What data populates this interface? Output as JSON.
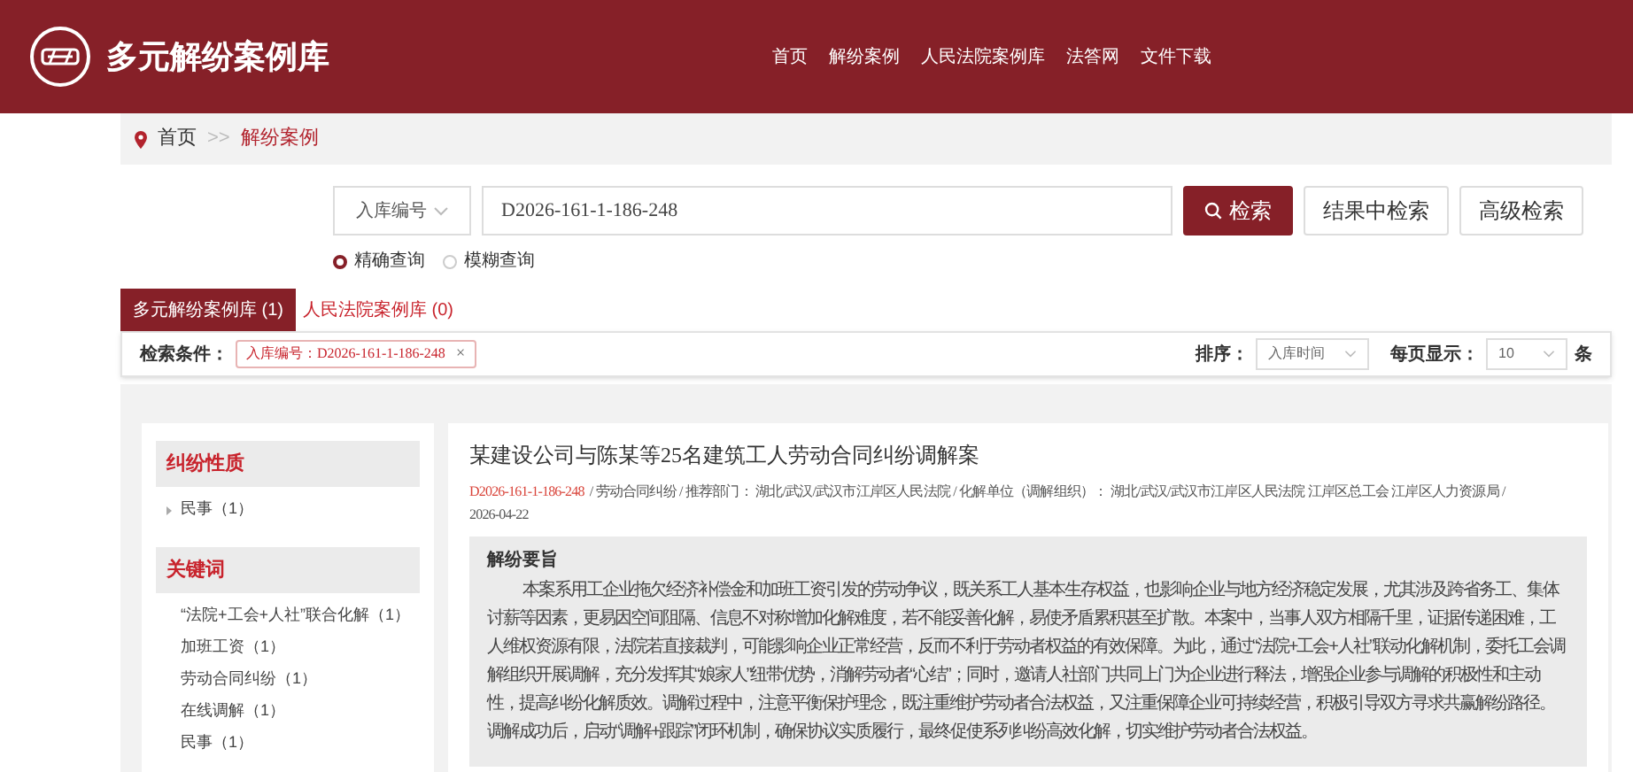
{
  "header": {
    "site_title": "多元解纷案例库",
    "nav": [
      {
        "label": "首页"
      },
      {
        "label": "解纷案例"
      },
      {
        "label": "人民法院案例库"
      },
      {
        "label": "法答网"
      },
      {
        "label": "文件下载"
      }
    ]
  },
  "breadcrumb": [
    {
      "label": "首页",
      "kind": "link",
      "current": false
    },
    {
      "label": ">>",
      "kind": "separator"
    },
    {
      "label": "解纷案例",
      "kind": "link",
      "current": true
    }
  ],
  "search": {
    "field": "入库编号",
    "value": "D2026-161-1-186-248",
    "buttons": [
      {
        "label": "检索",
        "kind": "primary"
      },
      {
        "label": "结果中检索",
        "kind": "secondary"
      },
      {
        "label": "高级检索",
        "kind": "secondary"
      }
    ],
    "modes": [
      {
        "label": "精确查询",
        "selected": true
      },
      {
        "label": "模糊查询",
        "selected": false
      }
    ]
  },
  "tabs": [
    {
      "label": "多元解纷案例库 (1)",
      "selected": true
    },
    {
      "label": "人民法院案例库 (0)",
      "selected": false
    }
  ],
  "filters": {
    "label": "检索条件：",
    "tags": [
      {
        "label": "入库编号：D2026-161-1-186-248",
        "close": "×"
      }
    ],
    "sort_label": "排序：",
    "sort_value": "入库时间",
    "page_size_label": "每页显示：",
    "page_size": "10",
    "page_size_unit": "条"
  },
  "sidebar": [
    {
      "title": "纠纷性质",
      "items": [
        {
          "label": "民事（1）",
          "kind": "bullet"
        }
      ]
    },
    {
      "title": "关键词",
      "items": [
        {
          "label": "“法院+工会+人社”联合化解（1）",
          "kind": "plain"
        },
        {
          "label": "加班工资（1）",
          "kind": "plain"
        },
        {
          "label": "劳动合同纠纷（1）",
          "kind": "plain"
        },
        {
          "label": "在线调解（1）",
          "kind": "plain"
        },
        {
          "label": "民事（1）",
          "kind": "plain"
        }
      ]
    }
  ],
  "result": {
    "title": "某建设公司与陈某等25名建筑工人劳动合同纠纷调解案",
    "case_no": "D2026-161-1-186-248",
    "details": "/ 劳动合同纠纷 / 推荐部门： 湖北/武汉/武汉市江岸区人民法院 / 化解单位（调解组织）： 湖北/武汉/武汉市江岸区人民法院 江岸区总工会 江岸区人力资源局 /",
    "date": "2026-04-22",
    "summary_heading": "解纷要旨",
    "summary": "本案系用工企业拖欠经济补偿金和加班工资引发的劳动争议，既关系工人基本生存权益，也影响企业与地方经济稳定发展，尤其涉及跨省务工、集体讨薪等因素，更易因空间阻隔、信息不对称增加化解难度，若不能妥善化解，易使矛盾累积甚至扩散。本案中，当事人双方相隔千里，证据传递困难，工人维权资源有限，法院若直接裁判，可能影响企业正常经营，反而不利于劳动者权益的有效保障。为此，通过“法院+工会+人社”联动化解机制，委托工会调解组织开展调解，充分发挥其“娘家人”纽带优势，消解劳动者“心结”；同时，邀请人社部门共同上门为企业进行释法，增强企业参与调解的积极性和主动性，提高纠纷化解质效。调解过程中，注意平衡保护理念，既注重维护劳动者合法权益，又注重保障企业可持续经营，积极引导双方寻求共赢解纷路径。调解成功后，启动“调解+跟踪”闭环机制，确保协议实质履行，最终促使系列纠纷高效化解，切实维护劳动者合法权益。"
  }
}
